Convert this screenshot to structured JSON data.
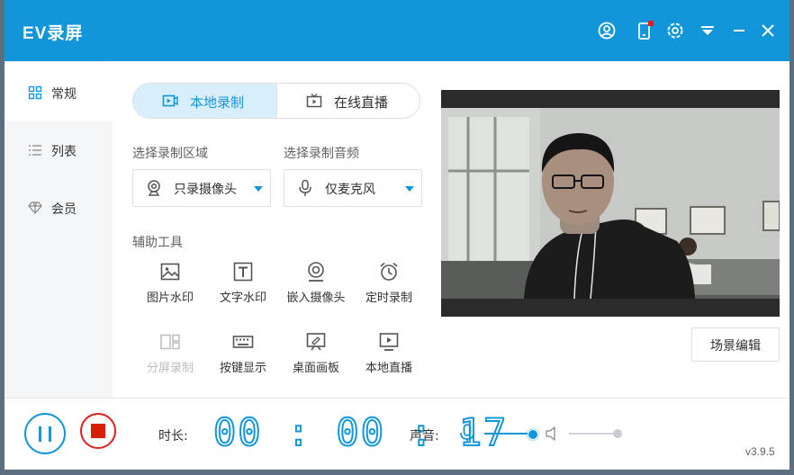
{
  "app": {
    "title": "EV录屏",
    "version": "v3.9.5",
    "accent_color": "#1296db",
    "titlebar_icons": [
      "user-icon",
      "phone-icon",
      "settings-icon",
      "dropdown-icon",
      "minimize-icon",
      "close-icon"
    ]
  },
  "sidebar": {
    "items": [
      {
        "label": "常规",
        "icon": "grid-icon",
        "active": true
      },
      {
        "label": "列表",
        "icon": "list-icon",
        "active": false
      },
      {
        "label": "会员",
        "icon": "diamond-icon",
        "active": false
      }
    ]
  },
  "tabs": [
    {
      "label": "本地录制",
      "icon": "record-icon",
      "active": true
    },
    {
      "label": "在线直播",
      "icon": "tv-icon",
      "active": false
    }
  ],
  "record_area": {
    "label": "选择录制区域",
    "value": "只录摄像头",
    "icon": "webcam-icon"
  },
  "record_audio": {
    "label": "选择录制音频",
    "value": "仅麦克风",
    "icon": "microphone-icon"
  },
  "tools": {
    "label": "辅助工具",
    "items": [
      {
        "label": "图片水印",
        "icon": "image-icon",
        "enabled": true
      },
      {
        "label": "文字水印",
        "icon": "text-icon",
        "enabled": true
      },
      {
        "label": "嵌入摄像头",
        "icon": "webcam-icon",
        "enabled": true
      },
      {
        "label": "定时录制",
        "icon": "alarm-clock-icon",
        "enabled": true
      },
      {
        "label": "分屏录制",
        "icon": "split-screen-icon",
        "enabled": false
      },
      {
        "label": "按键显示",
        "icon": "keyboard-icon",
        "enabled": true
      },
      {
        "label": "桌面画板",
        "icon": "easel-icon",
        "enabled": true
      },
      {
        "label": "本地直播",
        "icon": "monitor-play-icon",
        "enabled": true
      }
    ]
  },
  "scene_edit": {
    "label": "场景编辑"
  },
  "bottom": {
    "duration_label": "时长:",
    "timer": "00:00:17",
    "sound_label": "声音:",
    "mic_volume": 0.95,
    "speaker_volume": 1.0
  }
}
